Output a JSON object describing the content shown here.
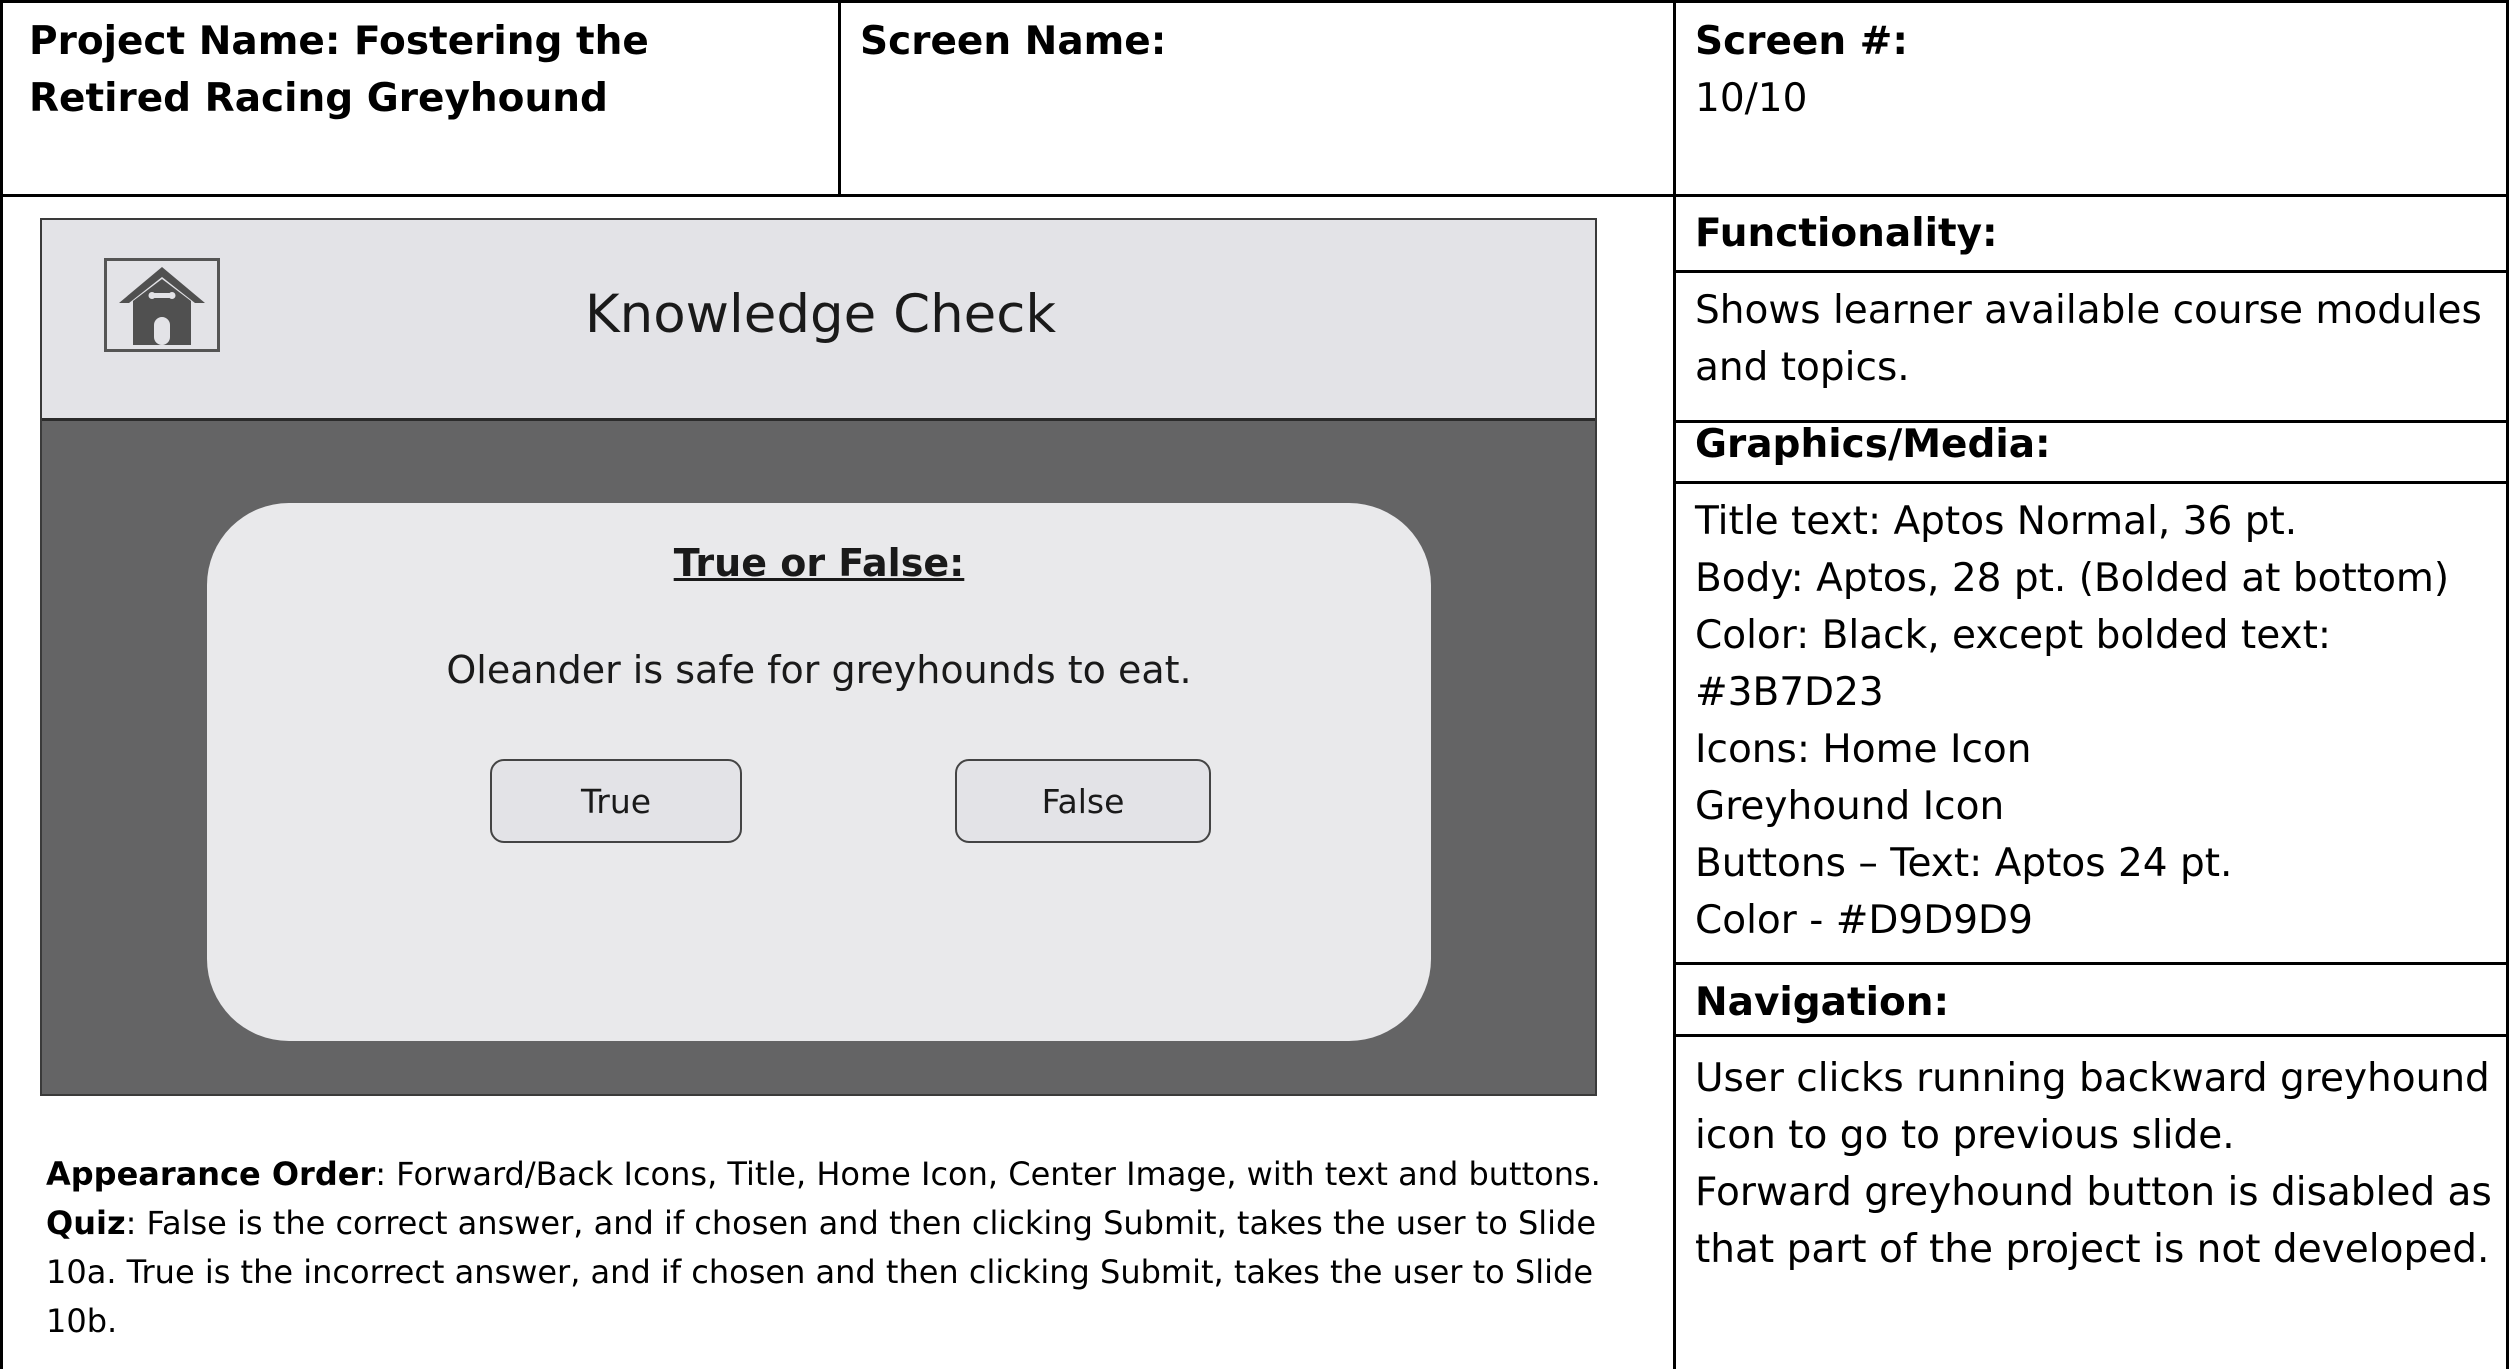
{
  "header": {
    "project_label": "Project Name: Fostering the Retired Racing Greyhound",
    "screen_name_label": "Screen Name:",
    "screen_number_label": "Screen #:",
    "screen_number_value": "10/10"
  },
  "slide": {
    "title": "Knowledge Check",
    "home_icon": "home-icon",
    "card": {
      "heading": "True or False:",
      "question": "Oleander is safe for greyhounds to eat.",
      "true_label": "True",
      "false_label": "False"
    }
  },
  "notes": {
    "appearance_label": "Appearance Order",
    "appearance_text": ": Forward/Back Icons, Title, Home Icon, Center Image, with text and buttons.",
    "quiz_label": "Quiz",
    "quiz_text": ": False is the correct answer, and if chosen and then clicking Submit, takes the user to Slide 10a. True is the incorrect answer, and if chosen and then clicking Submit, takes the user to Slide 10b."
  },
  "sidebar": {
    "functionality_label": "Functionality:",
    "functionality_text": "Shows learner available course modules and topics.",
    "graphics_label": "Graphics/Media:",
    "graphics_lines": [
      "Title text: Aptos Normal, 36 pt.",
      "Body: Aptos, 28 pt. (Bolded at bottom)",
      "Color: Black, except bolded text:",
      "#3B7D23",
      "Icons: Home Icon",
      "Greyhound Icon",
      "Buttons – Text: Aptos 24 pt.",
      "Color - #D9D9D9"
    ],
    "navigation_label": "Navigation:",
    "navigation_lines": [
      "User clicks running backward greyhound",
      "icon to go to previous slide.",
      "Forward greyhound button is disabled as",
      "that part of the project is not developed."
    ]
  }
}
